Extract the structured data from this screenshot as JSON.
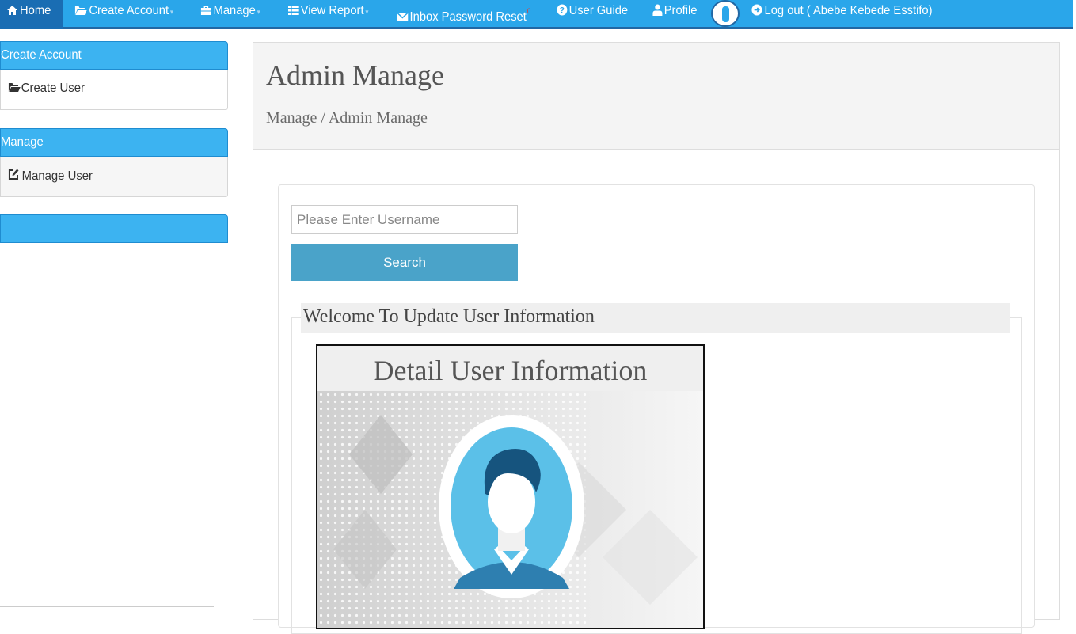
{
  "nav": {
    "home": "Home",
    "create_account": "Create Account",
    "manage": "Manage",
    "view_report": "View Report",
    "inbox": "Inbox Password Reset",
    "inbox_count": "0",
    "user_guide": "User Guide",
    "profile": "Profile",
    "logout": "Log out ( Abebe Kebede Esstifo)"
  },
  "sidebar": {
    "panels": [
      {
        "title": "Create Account",
        "link": "Create User"
      },
      {
        "title": "Manage",
        "link": "Manage User"
      },
      {
        "title": ""
      }
    ]
  },
  "main": {
    "title": "Admin Manage",
    "breadcrumb": "Manage / Admin Manage",
    "search_placeholder": "Please Enter Username",
    "search_button": "Search",
    "section_title": "Welcome To Update User Information",
    "detail_title": "Detail User Information"
  },
  "colors": {
    "nav_bg": "#2aa6ea",
    "nav_active": "#1a6db3",
    "panel_head": "#3cb3f1",
    "search_button": "#4aa3c9",
    "avatar_blue": "#5bc0e8"
  }
}
